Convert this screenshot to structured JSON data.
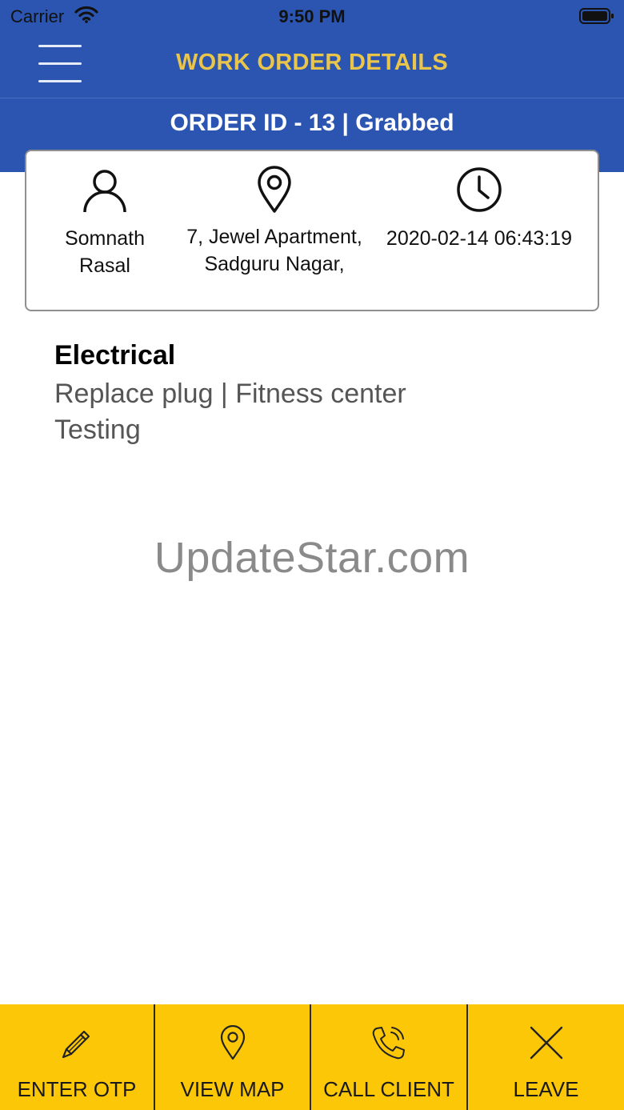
{
  "status_bar": {
    "carrier": "Carrier",
    "time": "9:50 PM"
  },
  "header": {
    "title": "WORK ORDER DETAILS",
    "order_line": "ORDER ID - 13 | Grabbed"
  },
  "info_card": {
    "client_name": "Somnath Rasal",
    "address": "7, Jewel Apartment, Sadguru Nagar,",
    "datetime": "2020-02-14 06:43:19"
  },
  "job": {
    "category": "Electrical",
    "description_line1": "Replace plug | Fitness center",
    "description_line2": "Testing"
  },
  "watermark": "UpdateStar.com",
  "actions": [
    {
      "label": "ENTER OTP",
      "icon": "pencil-icon"
    },
    {
      "label": "VIEW MAP",
      "icon": "location-pin-icon"
    },
    {
      "label": "CALL CLIENT",
      "icon": "phone-icon"
    },
    {
      "label": "LEAVE",
      "icon": "close-icon"
    }
  ],
  "colors": {
    "header_blue": "#2b55b0",
    "title_gold": "#e9c54b",
    "action_yellow": "#fcc707"
  }
}
